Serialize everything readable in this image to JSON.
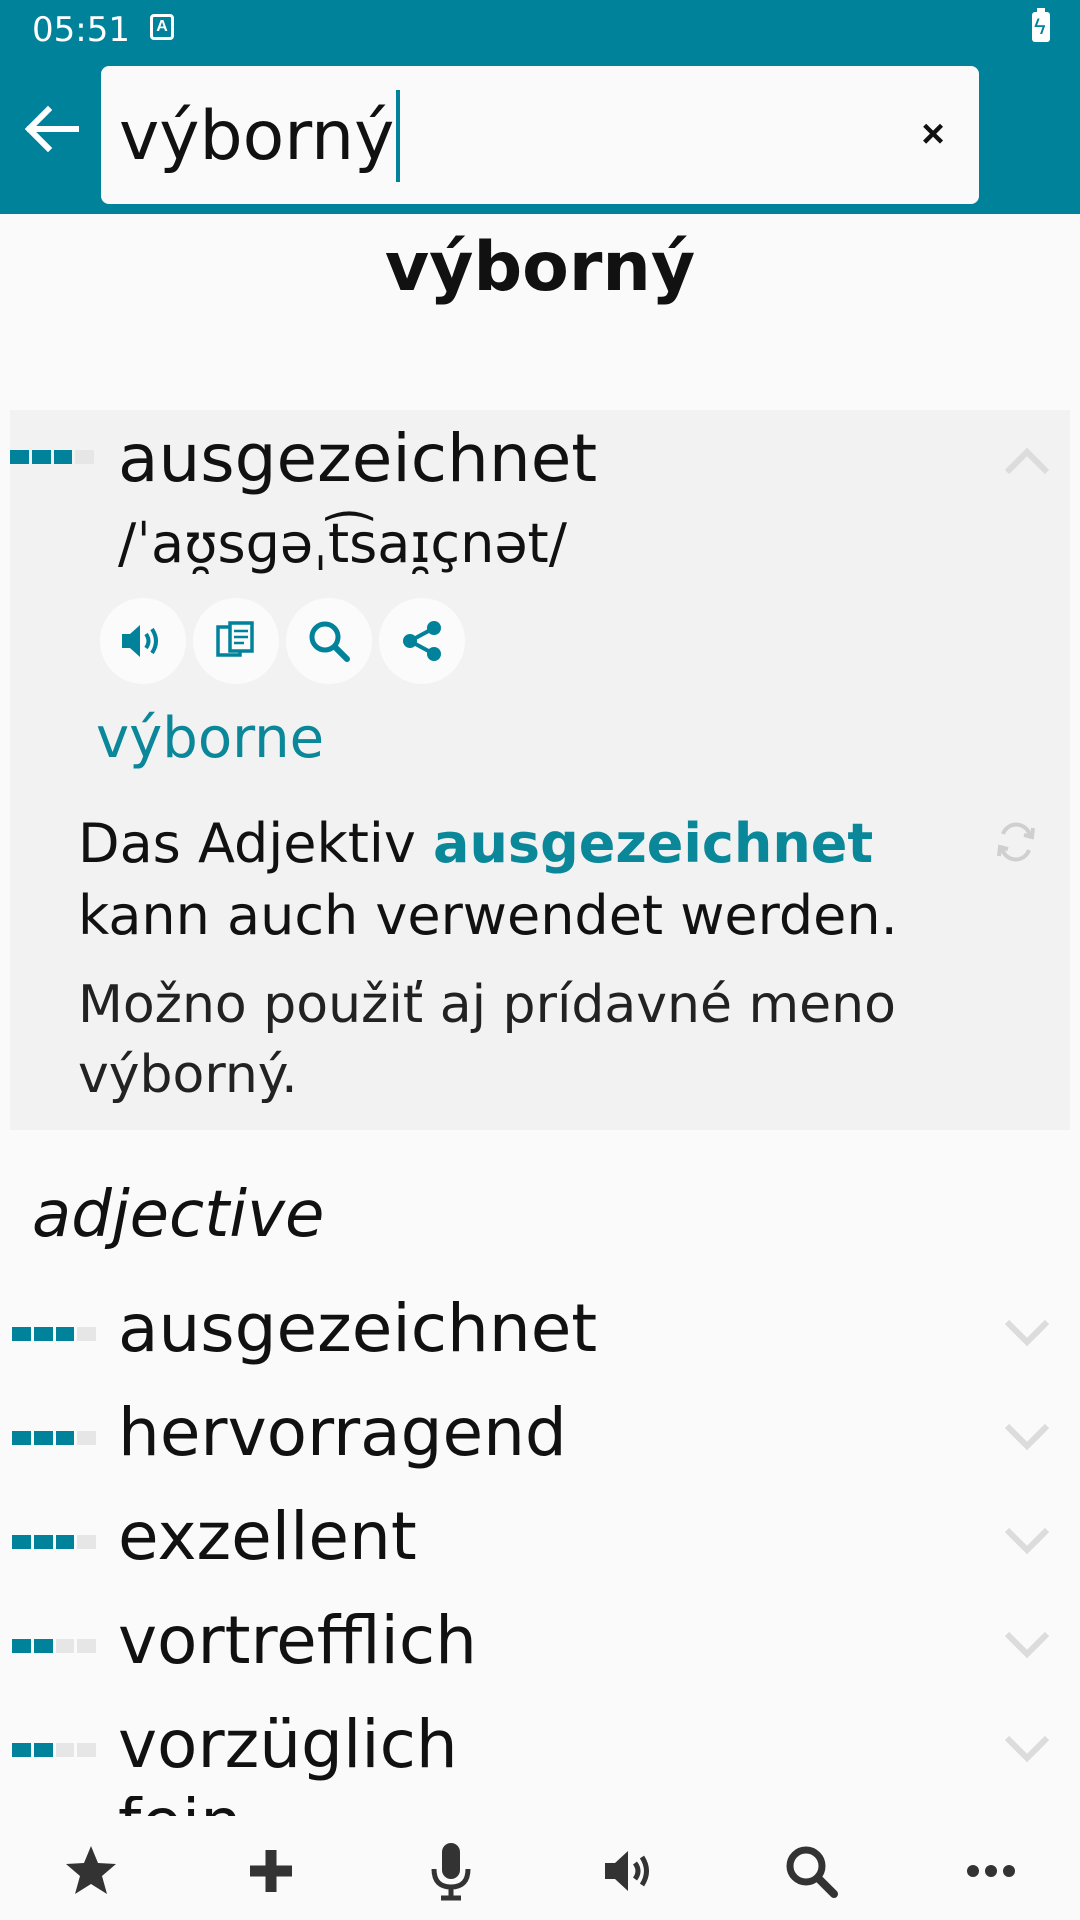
{
  "status": {
    "time": "05:51",
    "indicator": "A"
  },
  "search": {
    "query": "výborný",
    "clear_label": "×"
  },
  "headword": "výborný",
  "entry": {
    "word": "ausgezeichnet",
    "ipa": "/ˈaʊ̯sɡəˌt͡saɪ̯çnət/",
    "translation": "výborne",
    "example_de_prefix": "Das Adjektiv ",
    "example_de_highlight": "ausgezeichnet",
    "example_de_suffix": " kann auch verwendet werden.",
    "example_sk": "Možno použiť aj prídavné meno výborný.",
    "frequency": 3
  },
  "part_of_speech": "adjective",
  "translations": [
    {
      "word": "ausgezeichnet",
      "frequency": 3
    },
    {
      "word": "hervorragend",
      "frequency": 3
    },
    {
      "word": "exzellent",
      "frequency": 3
    },
    {
      "word": "vortrefflich",
      "frequency": 2
    },
    {
      "word": "vorzüglich",
      "frequency": 2
    }
  ],
  "partial_item": "fein",
  "colors": {
    "primary": "#00829a",
    "accent": "#0a8799"
  },
  "icons": {
    "actions": [
      "speaker-icon",
      "copy-icon",
      "search-icon",
      "share-icon"
    ],
    "nav": [
      "star-icon",
      "plus-icon",
      "microphone-icon",
      "speaker-icon",
      "search-icon",
      "more-icon"
    ]
  }
}
